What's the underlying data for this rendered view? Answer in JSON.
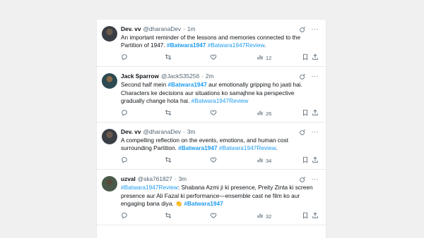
{
  "tweets": [
    {
      "name": "Dev. vv",
      "handle": "@dharanaDev",
      "time": "1m",
      "text_parts": [
        {
          "t": "An important reminder of the lessons and memories connected to the Partition of 1947. ",
          "kind": "plain"
        },
        {
          "t": "#Batwara1947",
          "kind": "tag-bold"
        },
        {
          "t": " ",
          "kind": "plain"
        },
        {
          "t": "#Batwara1947Review",
          "kind": "tag"
        },
        {
          "t": ".",
          "kind": "plain"
        }
      ],
      "views": "12"
    },
    {
      "name": "Jack Sparrow",
      "handle": "@JackS35256",
      "time": "2m",
      "text_parts": [
        {
          "t": "Second half mein ",
          "kind": "plain"
        },
        {
          "t": "#Batwara1947",
          "kind": "tag-bold"
        },
        {
          "t": " aur emotionally gripping ho jaati hai. Characters ke decisions aur situations ko samajhne ka perspective gradually change hota hai. ",
          "kind": "plain"
        },
        {
          "t": "#Batwara1947Review",
          "kind": "tag"
        }
      ],
      "views": "26"
    },
    {
      "name": "Dev. vv",
      "handle": "@dharanaDev",
      "time": "3m",
      "text_parts": [
        {
          "t": "A compelling reflection on the events, emotions, and human cost surrounding Partition. ",
          "kind": "plain"
        },
        {
          "t": "#Batwara1947",
          "kind": "tag-bold"
        },
        {
          "t": " ",
          "kind": "plain"
        },
        {
          "t": "#Batwara1947Review",
          "kind": "tag"
        },
        {
          "t": ".",
          "kind": "plain"
        }
      ],
      "views": "34"
    },
    {
      "name": "uzval",
      "handle": "@ska761827",
      "time": "3m",
      "text_parts": [
        {
          "t": "#Batwara1947Review",
          "kind": "tag"
        },
        {
          "t": ": Shabana Azmi ji ki presence, Preity Zinta ki screen presence aur Ali Fazal ki performance—ensemble cast ne film ko aur engaging bana diya. ",
          "kind": "plain"
        },
        {
          "t": "👏",
          "kind": "emoji"
        },
        {
          "t": " ",
          "kind": "plain"
        },
        {
          "t": "#Batwara1947",
          "kind": "tag-bold"
        }
      ],
      "views": "32"
    }
  ],
  "separator": "·",
  "more_glyph": "···"
}
